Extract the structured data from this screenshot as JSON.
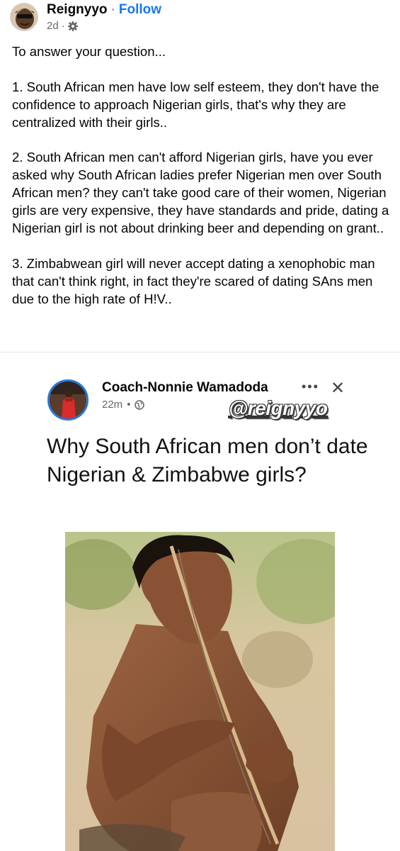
{
  "post": {
    "author": "Reignyyo",
    "separator": "·",
    "follow_label": "Follow",
    "time": "2d",
    "sub_sep": "·",
    "paragraphs": [
      "To answer your question...",
      "1. South African men have low self esteem, they don't have the confidence to approach Nigerian girls, that's why they are centralized with their girls..",
      "2. South African men can't afford Nigerian girls, have you ever asked why South African ladies prefer Nigerian men over South African men? they can't take good care of their women, Nigerian girls are very expensive, they have standards and pride, dating a Nigerian girl is not about drinking beer and depending on grant..",
      "3. Zimbabwean girl will never accept dating a xenophobic man that can't think right, in fact they're scared of dating SAns men due to the high rate of H!V.."
    ]
  },
  "shared": {
    "author": "Coach-Nonnie Wamadoda",
    "time": "22m",
    "sub_sep": "•",
    "more_label": "•••",
    "close_label": "✕",
    "watermark": "@reignyyo",
    "title": "Why South African men don’t date Nigerian & Zimbabwe girls?"
  },
  "icons": {
    "settings": "gear-icon",
    "audience": "globe-icon",
    "more": "more-options-icon",
    "close": "close-icon"
  },
  "colors": {
    "link": "#1877f2",
    "muted": "#65676b",
    "avatar_ring": "#2a79d8"
  }
}
